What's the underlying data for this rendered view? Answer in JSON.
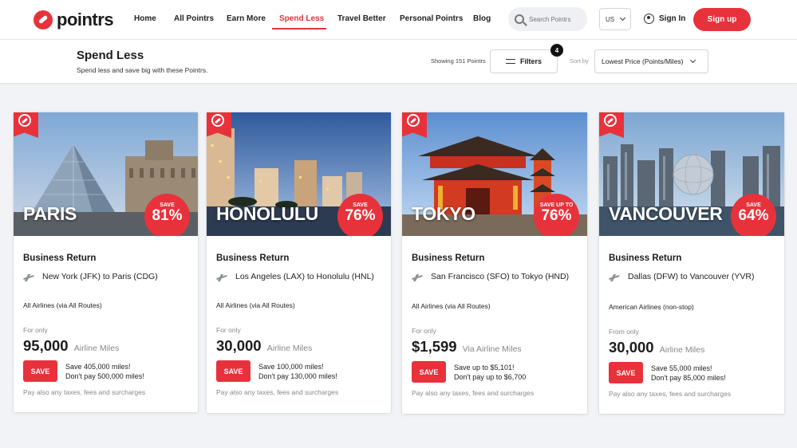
{
  "nav": {
    "brand": "pointrs",
    "links": [
      "Home",
      "All Pointrs",
      "Earn More",
      "Spend Less",
      "Travel Better",
      "Personal Pointrs",
      "Blog"
    ],
    "active": "Spend Less",
    "search_placeholder": "Search Pointrs",
    "country": "US",
    "signin": "Sign In",
    "signup": "Sign up"
  },
  "header": {
    "title": "Spend Less",
    "subtitle": "Spend less and save big with these Pointrs.",
    "showing": "Showing 151 Pointrs",
    "filters_label": "Filters",
    "filters_count": "4",
    "sort_label": "Sort by",
    "sort_value": "Lowest Price (Points/Miles)"
  },
  "accent_color": "#e8323b",
  "cards": [
    {
      "city": "PARIS",
      "save_label": "SAVE",
      "save_pct": "81%",
      "title": "Business Return",
      "route": "New York (JFK) to Paris (CDG)",
      "airline": "All Airlines (via All Routes)",
      "for_only": "For only",
      "price": "95,000",
      "unit": "Airline Miles",
      "save_btn": "SAVE",
      "save_line1": "Save 405,000 miles!",
      "save_line2": "Don't pay 500,000 miles!",
      "taxes": "Pay also any taxes, fees and surcharges"
    },
    {
      "city": "HONOLULU",
      "save_label": "SAVE",
      "save_pct": "76%",
      "title": "Business Return",
      "route": "Los Angeles (LAX) to Honolulu (HNL)",
      "airline": "All Airlines (via All Routes)",
      "for_only": "For only",
      "price": "30,000",
      "unit": "Airline Miles",
      "save_btn": "SAVE",
      "save_line1": "Save 100,000 miles!",
      "save_line2": "Don't pay 130,000 miles!",
      "taxes": "Pay also any taxes, fees and surcharges"
    },
    {
      "city": "TOKYO",
      "save_label": "SAVE UP TO",
      "save_pct": "76%",
      "title": "Business Return",
      "route": "San Francisco (SFO) to Tokyo (HND)",
      "airline": "All Airlines (via All Routes)",
      "for_only": "For only",
      "price": "$1,599",
      "unit": "Via Airline Miles",
      "save_btn": "SAVE",
      "save_line1": "Save up to $5,101!",
      "save_line2": "Don't pay up to $6,700",
      "taxes": "Pay also any taxes, fees and surcharges"
    },
    {
      "city": "VANCOUVER",
      "save_label": "SAVE",
      "save_pct": "64%",
      "title": "Business Return",
      "route": "Dallas (DFW) to Vancouver (YVR)",
      "airline": "American Airlines (non-stop)",
      "for_only": "From only",
      "price": "30,000",
      "unit": "Airline Miles",
      "save_btn": "SAVE",
      "save_line1": "Save 55,000 miles!",
      "save_line2": "Don't pay 85,000 miles!",
      "taxes": "Pay also any taxes, fees and surcharges"
    }
  ]
}
